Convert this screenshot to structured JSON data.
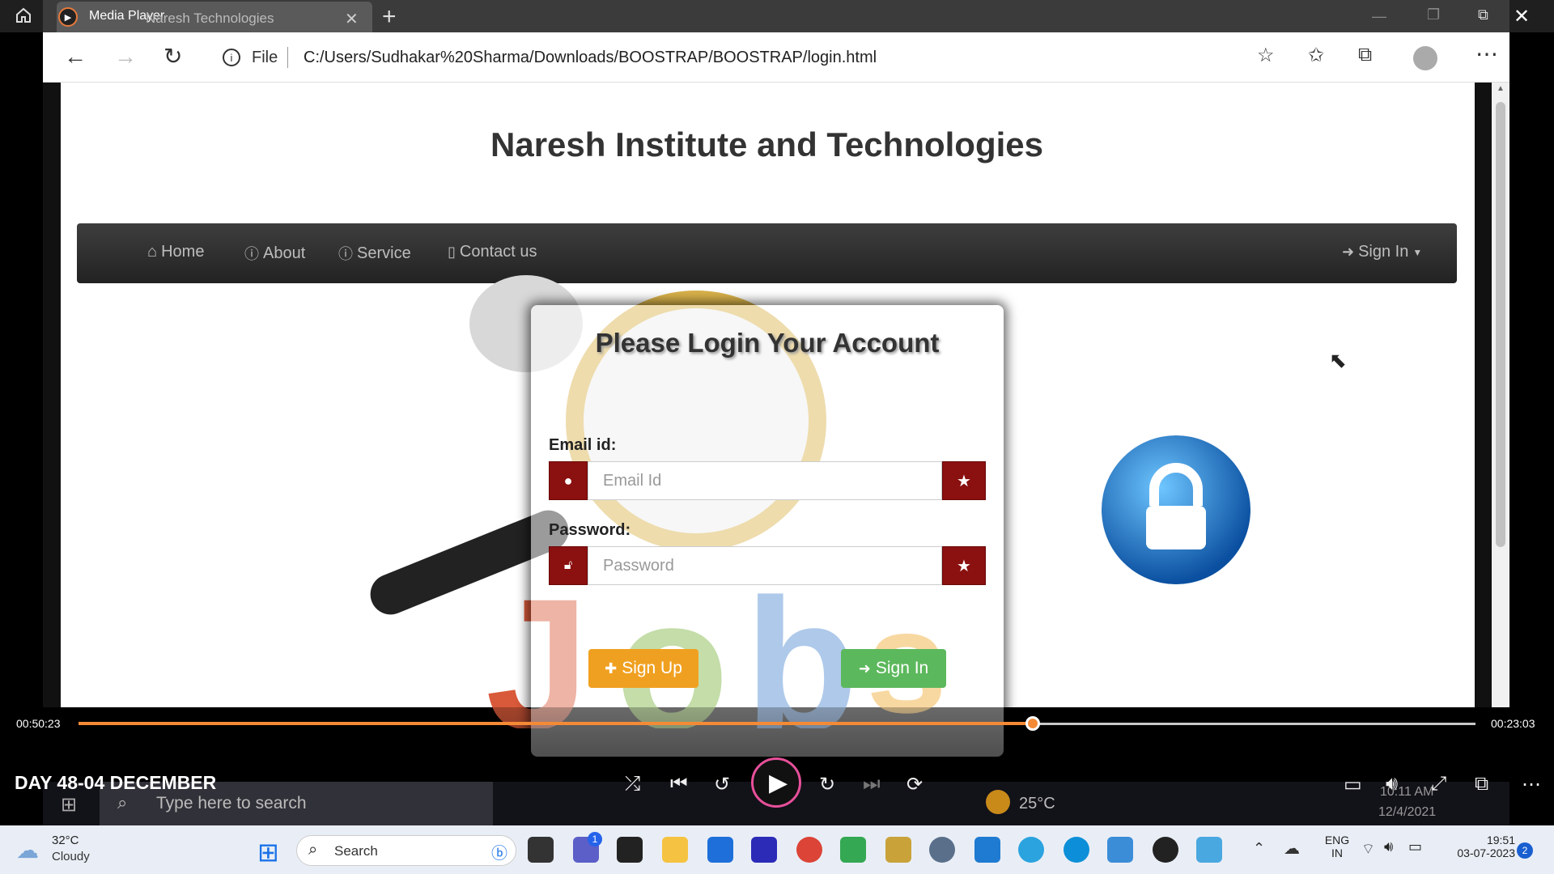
{
  "player": {
    "title": "Media Player",
    "elapsed": "00:50:23",
    "remaining": "00:23:03",
    "progress": 0.683,
    "video_title": "DAY 48-04 DECEMBER"
  },
  "browser": {
    "tab_title": "Naresh Technologies",
    "address_prefix": "File",
    "url": "C:/Users/Sudhakar%20Sharma/Downloads/BOOSTRAP/BOOSTRAP/login.html"
  },
  "page": {
    "heading": "Naresh Institute and Technologies",
    "nav": {
      "home": "Home",
      "about": "About",
      "service": "Service",
      "contact": "Contact us",
      "signin": "Sign In"
    },
    "login": {
      "title": "Please Login Your Account",
      "email_label": "Email id:",
      "email_placeholder": "Email Id",
      "password_label": "Password:",
      "password_placeholder": "Password",
      "signup_button": "Sign Up",
      "signin_button": "Sign In"
    }
  },
  "inner_taskbar": {
    "search_placeholder": "Type here to search",
    "temperature": "25°C",
    "time": "10:11 AM",
    "date": "12/4/2021"
  },
  "taskbar": {
    "weather_temp": "32°C",
    "weather_desc": "Cloudy",
    "search_label": "Search",
    "lang_top": "ENG",
    "lang_bottom": "IN",
    "time": "19:51",
    "date": "03-07-2023",
    "notification_count": "2",
    "chat_badge": "1"
  },
  "colors": {
    "accent": "#f48a36",
    "danger": "#8b1010",
    "signup": "#f0a020",
    "signin": "#5cb85c"
  }
}
